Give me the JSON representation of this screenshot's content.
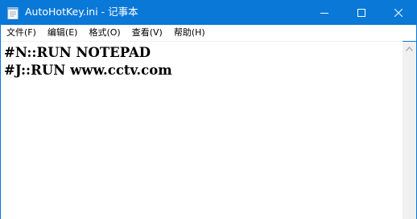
{
  "window": {
    "title": "AutoHotKey.ini - 记事本",
    "controls": {
      "minimize_icon": "minimize-icon",
      "maximize_icon": "maximize-icon",
      "close_icon": "close-icon"
    },
    "accent_color": "#0a78d7"
  },
  "menu": {
    "items": [
      {
        "label": "文件(F)"
      },
      {
        "label": "编辑(E)"
      },
      {
        "label": "格式(O)"
      },
      {
        "label": "查看(V)"
      },
      {
        "label": "帮助(H)"
      }
    ]
  },
  "editor": {
    "lines": [
      "#N::RUN NOTEPAD",
      "#J::RUN www.cctv.com"
    ]
  }
}
